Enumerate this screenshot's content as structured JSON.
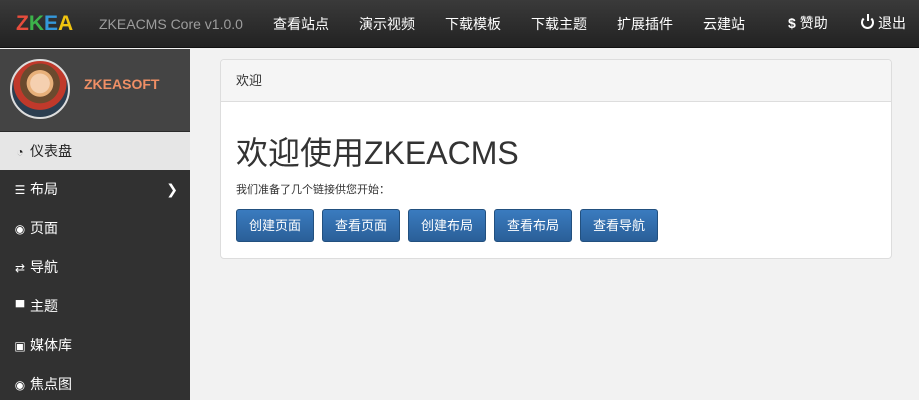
{
  "header": {
    "logo": {
      "z": "Z",
      "k": "K",
      "e": "E",
      "a": "A"
    },
    "brand": "ZKEACMS Core v1.0.0",
    "links": [
      "查看站点",
      "演示视频",
      "下载模板",
      "下载主题",
      "扩展插件",
      "云建站"
    ],
    "donate": "赞助",
    "logout": "退出"
  },
  "sidebar": {
    "username": "ZKEASOFT",
    "items": [
      {
        "label": "仪表盘",
        "icon": "dashboard-icon"
      },
      {
        "label": "布局",
        "icon": "layout-icon"
      },
      {
        "label": "页面",
        "icon": "eye-icon"
      },
      {
        "label": "导航",
        "icon": "retweet-icon"
      },
      {
        "label": "主题",
        "icon": "blackboard-icon"
      },
      {
        "label": "媒体库",
        "icon": "picture-icon"
      },
      {
        "label": "焦点图",
        "icon": "eye-icon"
      }
    ]
  },
  "main": {
    "panel_heading": "欢迎",
    "title": "欢迎使用ZKEACMS",
    "subtitle": "我们准备了几个链接供您开始：",
    "buttons": [
      "创建页面",
      "查看页面",
      "创建布局",
      "查看布局",
      "查看导航"
    ]
  },
  "colors": {
    "navbar": "#2b2b2b",
    "sidebar": "#313131",
    "username": "#f08f65",
    "button": "#2f6aa8"
  }
}
